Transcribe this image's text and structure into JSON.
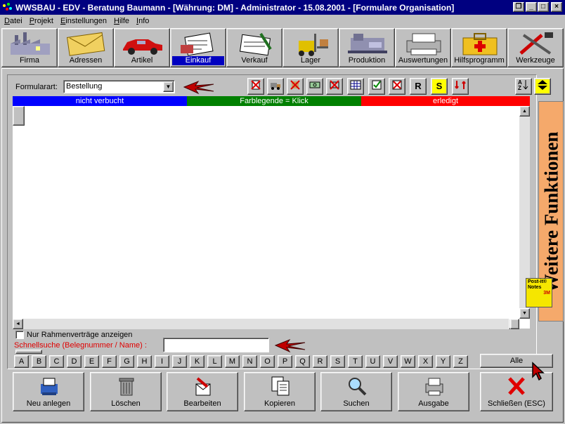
{
  "window": {
    "title": "WWSBAU - EDV - Beratung Baumann - [Währung: DM] - Administrator - 15.08.2001 - [Formulare Organisation]"
  },
  "menu": [
    {
      "label": "Datei",
      "u": "D",
      "rest": "atei"
    },
    {
      "label": "Projekt",
      "u": "P",
      "rest": "rojekt"
    },
    {
      "label": "Einstellungen",
      "u": "E",
      "rest": "instellungen"
    },
    {
      "label": "Hilfe",
      "u": "H",
      "rest": "ilfe"
    },
    {
      "label": "Info",
      "u": "I",
      "rest": "nfo"
    }
  ],
  "toolbar": [
    {
      "label": "Firma",
      "icon": "factory-icon"
    },
    {
      "label": "Adressen",
      "icon": "envelope-icon"
    },
    {
      "label": "Artikel",
      "icon": "car-icon"
    },
    {
      "label": "Einkauf",
      "icon": "purchase-icon",
      "active": true
    },
    {
      "label": "Verkauf",
      "icon": "sales-icon"
    },
    {
      "label": "Lager",
      "icon": "forklift-icon"
    },
    {
      "label": "Produktion",
      "icon": "production-icon"
    },
    {
      "label": "Auswertungen",
      "icon": "printer-icon"
    },
    {
      "label": "Hilfsprogramm",
      "icon": "first-aid-kit-icon"
    },
    {
      "label": "Werkzeuge",
      "icon": "tools-icon"
    }
  ],
  "form": {
    "formularart_label": "Formularart:",
    "formularart_value": "Bestellung",
    "legend": {
      "left": "nicht verbucht",
      "mid": "Farblegende = Klick",
      "right": "erledigt"
    },
    "checkbox_label": "Nur Rahmenverträge anzeigen",
    "search_label": "Schnellsuche (Belegnummer / Name) :",
    "search_value": "",
    "side_label": "Weitere Funktionen",
    "postit": {
      "line1": "Post-it®",
      "line2": "Notes",
      "line3": "3M"
    },
    "alle_label": "Alle",
    "r_label": "R",
    "s_label": "S"
  },
  "letters": [
    "A",
    "B",
    "C",
    "D",
    "E",
    "F",
    "G",
    "H",
    "I",
    "J",
    "K",
    "L",
    "M",
    "N",
    "O",
    "P",
    "Q",
    "R",
    "S",
    "T",
    "U",
    "V",
    "W",
    "X",
    "Y",
    "Z"
  ],
  "actions": [
    {
      "label": "Neu anlegen",
      "icon": "new-record-icon"
    },
    {
      "label": "Löschen",
      "icon": "trash-can-icon"
    },
    {
      "label": "Bearbeiten",
      "icon": "edit-icon"
    },
    {
      "label": "Kopieren",
      "icon": "copy-icon"
    },
    {
      "label": "Suchen",
      "icon": "magnifier-icon"
    },
    {
      "label": "Ausgabe",
      "icon": "printer-output-icon"
    },
    {
      "label": "Schließen (ESC)",
      "icon": "close-x-icon"
    }
  ],
  "colors": {
    "not_booked": "#0000ff",
    "legend": "#008000",
    "done": "#ff0000"
  }
}
